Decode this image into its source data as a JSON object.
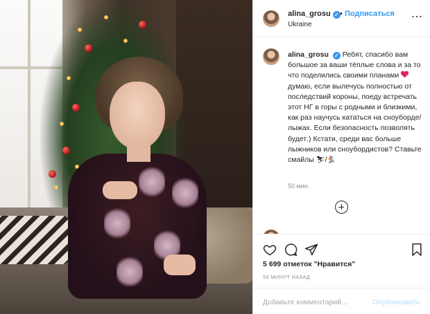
{
  "post": {
    "username": "alina_grosu",
    "verified_mark": "✓",
    "separator": "•",
    "follow_label": "Подписаться",
    "location": "Ukraine",
    "more_icon": "⋯"
  },
  "caption": {
    "username": "alina_grosu",
    "part1": "Ребят, спасибо вам большое за ваши тёплые слова и за то что поделились своими планами",
    "part2": "думаю, если вылечусь полностью от последствий короны, поеду встречать этот НГ в горы с родными и близкими, как раз научусь кататься на сноуборде/лыжах. Если безопасность позволять будет:) Кстати, среди вас больше лыжников или сноубордистов? Ставьте смайлы",
    "emoji_heart": "heart-emoji",
    "emoji_skis": "⛷",
    "emoji_board": "🏂",
    "emoji_sep": "/",
    "time": "50 мин."
  },
  "next_comment": {
    "text": "…"
  },
  "icons": {
    "like": "heart-icon",
    "comment": "comment-icon",
    "share": "share-icon",
    "save": "bookmark-icon",
    "load_more": "plus-circle-icon"
  },
  "likes_text": "5 699 отметок \"Нравится\"",
  "posted_text": "50 МИНУТ НАЗАД",
  "comment_box": {
    "placeholder": "Добавьте комментарий...",
    "post_label": "Опубликовать"
  },
  "colors": {
    "link": "#3897f0",
    "text": "#262626",
    "muted": "#8e8e8e",
    "post_disabled": "#b2dffc"
  }
}
